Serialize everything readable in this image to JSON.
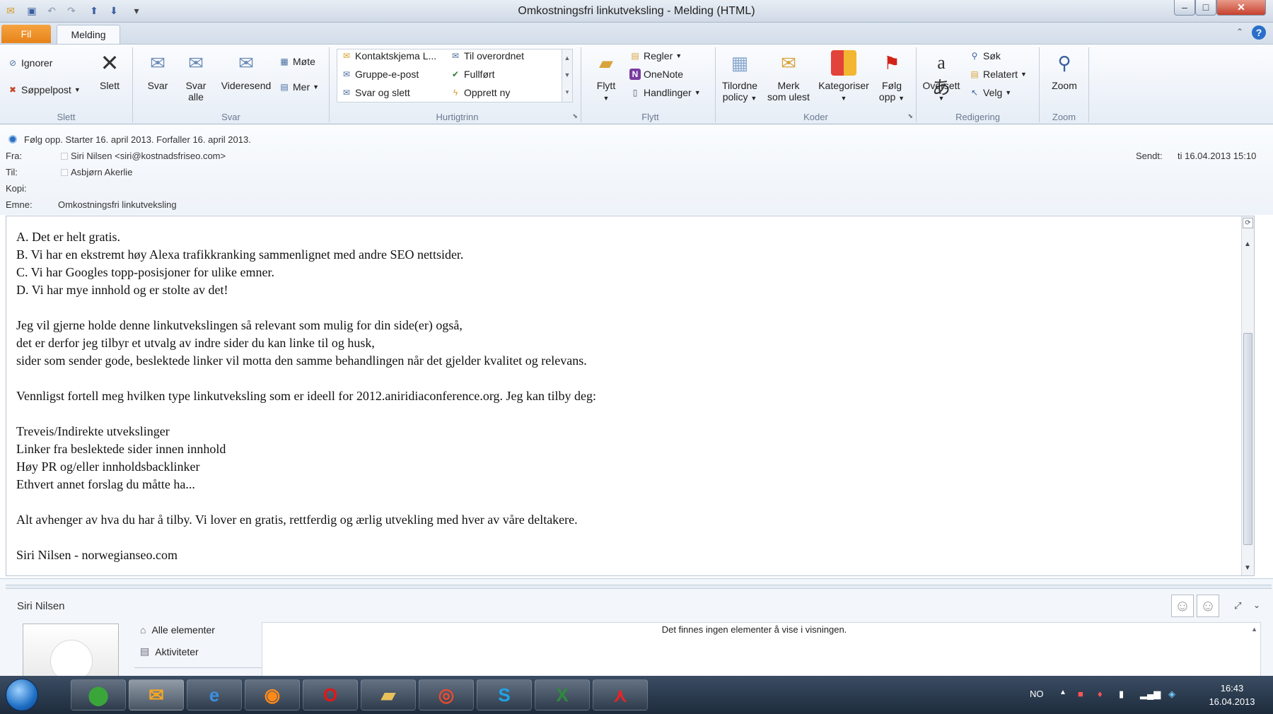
{
  "window": {
    "title": "Omkostningsfri linkutveksling  -  Melding (HTML)",
    "controls": {
      "minimize": "–",
      "maximize": "□",
      "close": "✕"
    }
  },
  "tabs": {
    "file": "Fil",
    "message": "Melding"
  },
  "ribbon": {
    "slett": {
      "label": "Slett",
      "ignore": "Ignorer",
      "junk": "Søppelpost",
      "delete": "Slett"
    },
    "svar": {
      "label": "Svar",
      "reply": "Svar",
      "reply_all_1": "Svar",
      "reply_all_2": "alle",
      "forward": "Videresend",
      "meeting": "Møte",
      "more": "Mer"
    },
    "hurtigtrinn": {
      "label": "Hurtigtrinn",
      "items": [
        "Kontaktskjema L...",
        "Gruppe-e-post",
        "Svar og slett",
        "Til overordnet",
        "Fullført",
        "Opprett ny"
      ]
    },
    "flytt": {
      "label": "Flytt",
      "move": "Flytt",
      "rules": "Regler",
      "onenote": "OneNote",
      "actions": "Handlinger"
    },
    "koder": {
      "label": "Koder",
      "policy_1": "Tilordne",
      "policy_2": "policy",
      "unread_1": "Merk",
      "unread_2": "som ulest",
      "categorize": "Kategoriser",
      "follow_1": "Følg",
      "follow_2": "opp"
    },
    "redigering": {
      "label": "Redigering",
      "translate": "Oversett",
      "search": "Søk",
      "related": "Relatert",
      "select": "Velg"
    },
    "zoom": {
      "label": "Zoom",
      "zoom": "Zoom"
    }
  },
  "message": {
    "followup": "Følg opp.  Starter 16. april 2013.  Forfaller 16. april 2013.",
    "from_label": "Fra:",
    "from_value": "Siri Nilsen <siri@kostnadsfriseo.com>",
    "to_label": "Til:",
    "to_value": "Asbjørn Akerlie",
    "cc_label": "Kopi:",
    "subject_label": "Emne:",
    "subject_value": "Omkostningsfri linkutveksling",
    "sent_label": "Sendt:",
    "sent_value": "ti 16.04.2013 15:10",
    "body": "A. Det er helt gratis.\nB. Vi har en ekstremt høy Alexa trafikkranking sammenlignet med andre SEO nettsider.\nC. Vi har Googles topp-posisjoner for ulike emner.\nD. Vi har mye innhold og er stolte av det!\n\nJeg vil gjerne holde denne linkutvekslingen så relevant som mulig for din side(er) også,\ndet er derfor jeg tilbyr et utvalg av indre sider du kan linke til og husk,\nsider som sender gode, beslektede linker vil motta den samme behandlingen når det gjelder kvalitet og relevans.\n\nVennligst fortell meg hvilken type linkutveksling som er ideell for 2012.aniridiaconference.org. Jeg kan tilby deg:\n\nTreveis/Indirekte utvekslinger\nLinker fra beslektede sider innen innhold\nHøy PR og/eller innholdsbacklinker\nEthvert annet forslag du måtte ha...\n\nAlt avhenger av hva du har å tilby. Vi lover en gratis, rettferdig og ærlig utvekling med hver av våre deltakere.\n\nSiri Nilsen - norwegianseo.com"
  },
  "people_pane": {
    "name": "Siri Nilsen",
    "all_items": "Alle elementer",
    "activities": "Aktiviteter",
    "empty": "Det finnes ingen elementer å vise i visningen."
  },
  "taskbar": {
    "lang": "NO",
    "time": "16:43",
    "date": "16.04.2013"
  }
}
